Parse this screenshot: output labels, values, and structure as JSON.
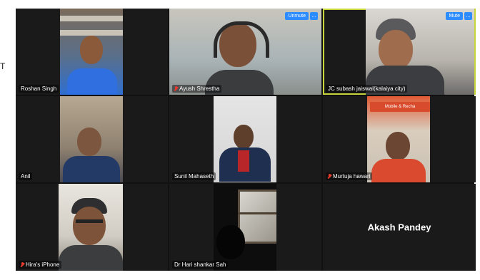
{
  "left_edge_char": "T",
  "participants": [
    {
      "name": "Roshan Singh",
      "muted": false
    },
    {
      "name": "Ayush Shrestha",
      "muted": true,
      "controls": {
        "mute_toggle_label": "Unmute",
        "more_label": "..."
      }
    },
    {
      "name": "JC subash jaiswal(kalaiya city)",
      "muted": false,
      "active_speaker": true,
      "controls": {
        "mute_toggle_label": "Mute",
        "more_label": "..."
      }
    },
    {
      "name": "Anil",
      "muted": false
    },
    {
      "name": "Sunil Mahaseth",
      "muted": false
    },
    {
      "name": "Murtuja hawari",
      "muted": true,
      "background_sign": "Mobile & Recha"
    },
    {
      "name": "Hira's iPhone",
      "muted": true
    },
    {
      "name": "Dr Hari shankar Sah",
      "muted": false
    },
    {
      "name": "Akash Pandey",
      "video_off": true
    }
  ],
  "colors": {
    "gallery_background": "#111111",
    "active_speaker_border": "#c6d63a",
    "button_blue": "#2d8cff",
    "muted_icon_red": "#e63b2e"
  }
}
